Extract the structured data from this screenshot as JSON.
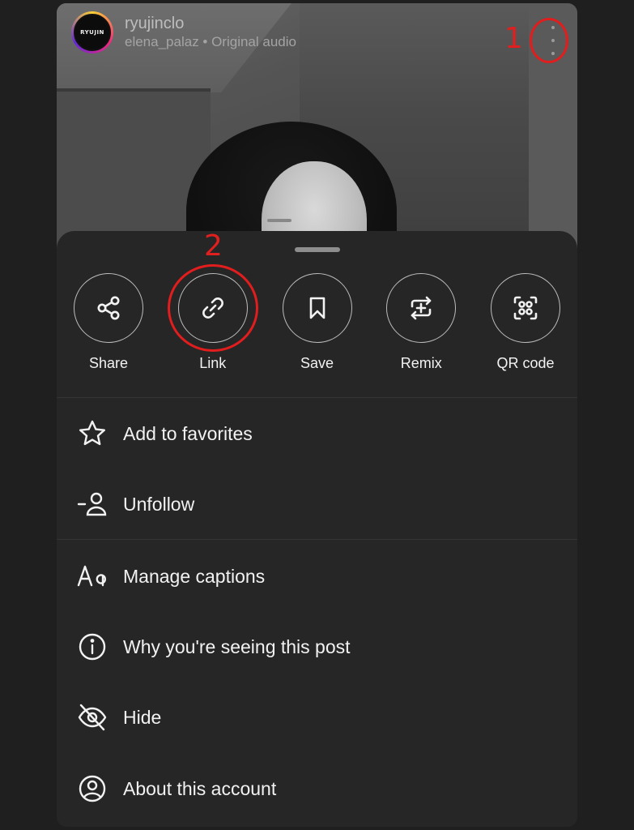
{
  "reel": {
    "avatar_text": "RYUJIN",
    "username": "ryujinclo",
    "subtitle": "elena_palaz • Original audio"
  },
  "annotations": {
    "step1": "1",
    "step2": "2",
    "color": "#e01f1f"
  },
  "actions": [
    {
      "label": "Share",
      "icon": "share-icon"
    },
    {
      "label": "Link",
      "icon": "link-icon"
    },
    {
      "label": "Save",
      "icon": "bookmark-icon"
    },
    {
      "label": "Remix",
      "icon": "remix-icon"
    },
    {
      "label": "QR code",
      "icon": "qr-code-icon"
    }
  ],
  "menu": [
    {
      "label": "Add to favorites",
      "icon": "star-icon"
    },
    {
      "label": "Unfollow",
      "icon": "unfollow-icon"
    },
    {
      "label": "Manage captions",
      "icon": "captions-icon"
    },
    {
      "label": "Why you're seeing this post",
      "icon": "info-icon"
    },
    {
      "label": "Hide",
      "icon": "eye-off-icon"
    },
    {
      "label": "About this account",
      "icon": "account-icon"
    }
  ],
  "colors": {
    "sheet_bg": "#262626",
    "page_bg": "#1f1f1f",
    "text": "#f2f2f2"
  }
}
